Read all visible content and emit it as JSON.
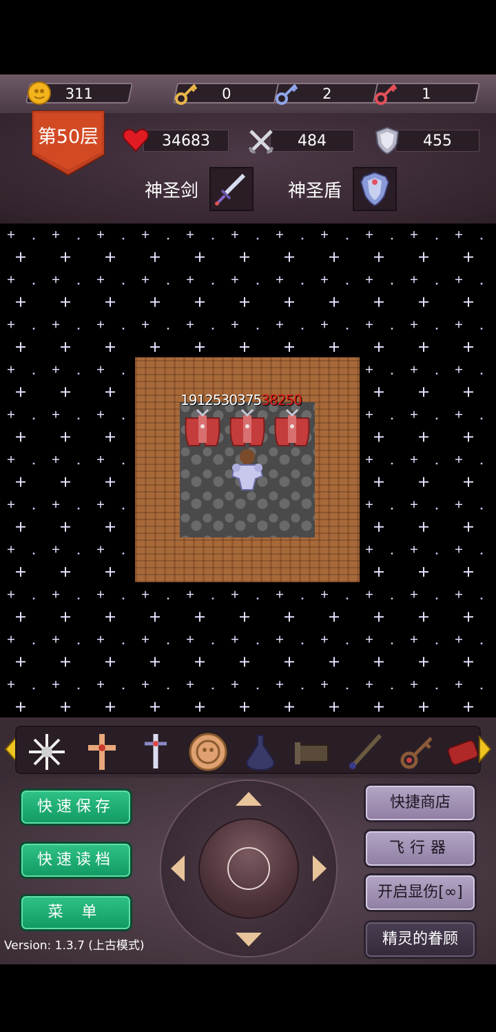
{
  "resources": {
    "gold": "311",
    "yellow_key": "0",
    "blue_key": "2",
    "red_key": "1"
  },
  "floor": {
    "label": "第50层"
  },
  "stats": {
    "hp": "34683",
    "attack": "484",
    "defense": "455"
  },
  "equipment": {
    "weapon_name": "神圣剑",
    "shield_name": "神圣盾"
  },
  "map": {
    "damage_numbers": [
      "1912",
      "5303",
      "75",
      "38250"
    ]
  },
  "tools": [
    "snowflake-cross-icon",
    "holy-cross-icon",
    "sword-emblem-icon",
    "monkey-coin-icon",
    "bomb-flask-icon",
    "scroll-icon",
    "flying-wand-icon",
    "magic-key-icon",
    "dynamite-icon"
  ],
  "buttons": {
    "quick_save": "快速保存",
    "quick_load": "快速读档",
    "menu": "菜 单",
    "quick_shop": "快捷商店",
    "flyer": "飞行器",
    "show_damage": "开启显伤[∞]",
    "fairy_blessing": "精灵的眷顾"
  },
  "version": "Version: 1.3.7 (上古模式)",
  "colors": {
    "green_button": "#1fae73",
    "purple_button": "#a293b5",
    "damage_red": "#e01818"
  }
}
